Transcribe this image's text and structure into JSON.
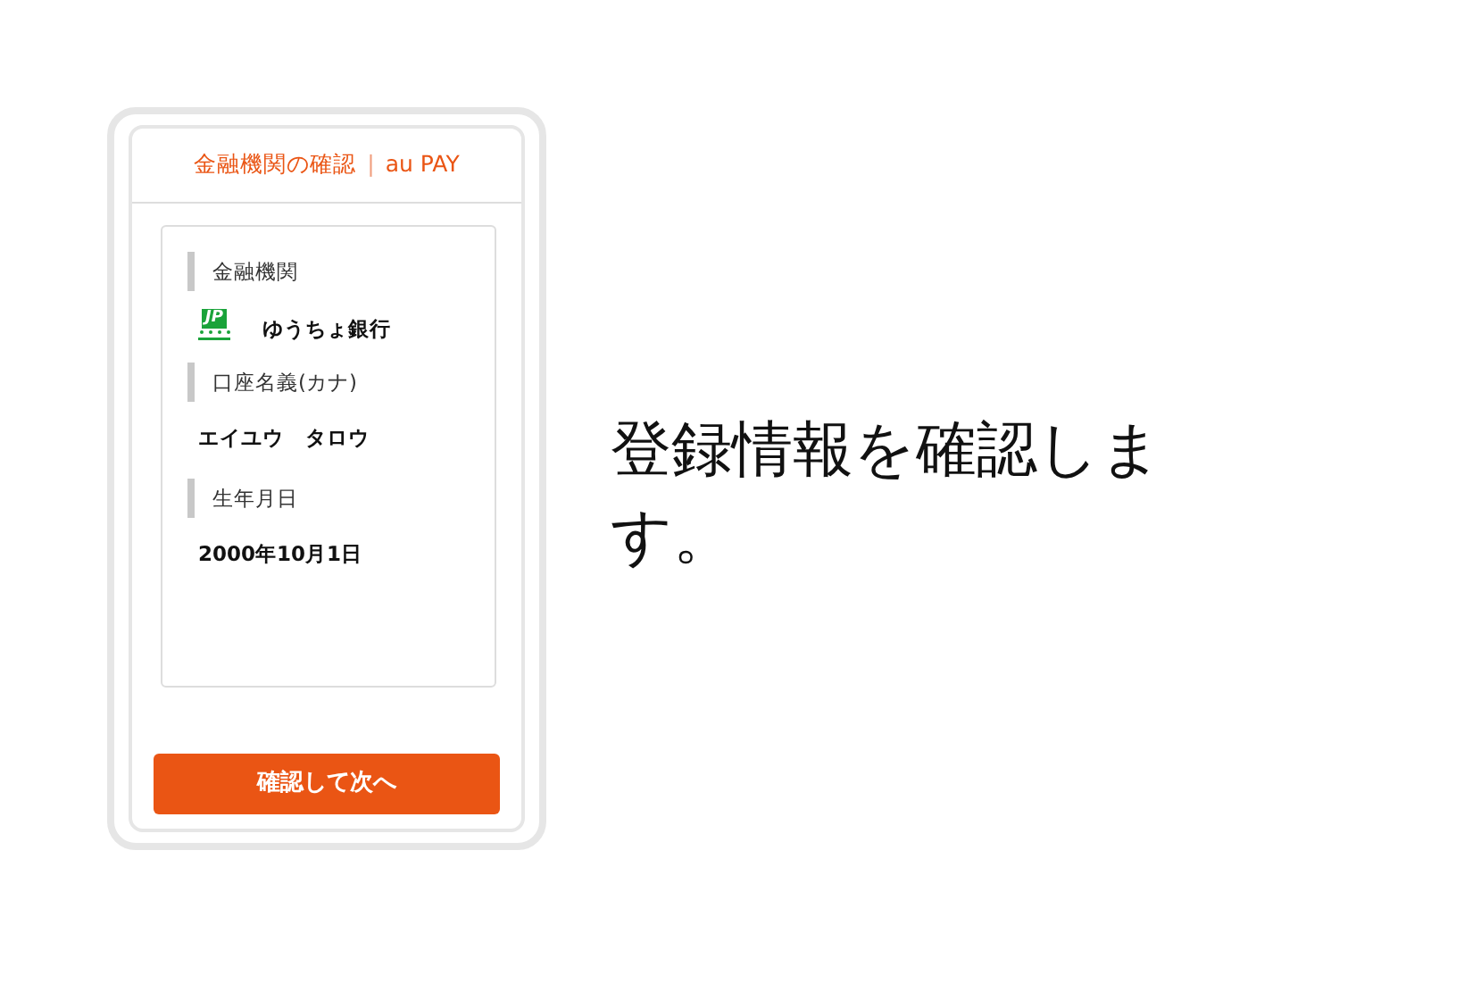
{
  "header": {
    "title": "金融機関の確認",
    "separator": "|",
    "brand": "au PAY"
  },
  "fields": [
    {
      "kind": "bank",
      "label": "金融機関",
      "logo_text": "JP",
      "value": "ゆうちょ銀行"
    },
    {
      "kind": "text",
      "label": "口座名義(カナ)",
      "value": "エイユウ　タロウ"
    },
    {
      "kind": "text",
      "label": "生年月日",
      "value": "2000年10月1日"
    }
  ],
  "button": "確認して次へ",
  "caption": "登録情報を確認します。"
}
